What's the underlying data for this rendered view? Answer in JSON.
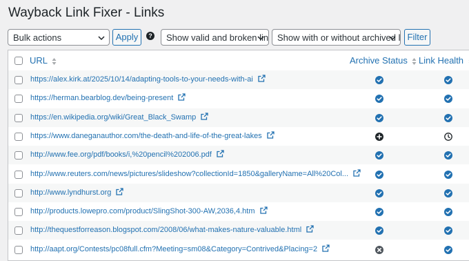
{
  "page": {
    "title": "Wayback Link Fixer - Links"
  },
  "toolbar": {
    "bulk_actions": "Bulk actions",
    "apply_label": "Apply",
    "help_glyph": "?",
    "validity_filter": "Show valid and broken links",
    "archive_filter": "Show with or without archived link",
    "filter_label": "Filter"
  },
  "table": {
    "columns": {
      "url": "URL",
      "archive_status": "Archive Status",
      "link_health": "Link Health"
    },
    "rows": [
      {
        "url": "https://alex.kirk.at/2025/10/14/adapting-tools-to-your-needs-with-ai",
        "archive_status": "archived",
        "link_health": "valid"
      },
      {
        "url": "https://herman.bearblog.dev/being-present",
        "archive_status": "archived",
        "link_health": "valid"
      },
      {
        "url": "https://en.wikipedia.org/wiki/Great_Black_Swamp",
        "archive_status": "archived",
        "link_health": "valid"
      },
      {
        "url": "https://www.daneganauthor.com/the-death-and-life-of-the-great-lakes",
        "archive_status": "add",
        "link_health": "pending"
      },
      {
        "url": "http://www.fee.org/pdf/books/i,%20pencil%202006.pdf",
        "archive_status": "archived",
        "link_health": "valid"
      },
      {
        "url": "http://www.reuters.com/news/pictures/slideshow?collectionId=1850&galleryName=All%20Col...",
        "archive_status": "archived",
        "link_health": "valid"
      },
      {
        "url": "http://www.lyndhurst.org",
        "archive_status": "archived",
        "link_health": "valid"
      },
      {
        "url": "http://products.lowepro.com/product/SlingShot-300-AW,2036,4.htm",
        "archive_status": "archived",
        "link_health": "valid"
      },
      {
        "url": "http://thequestforreason.blogspot.com/2008/06/what-makes-nature-valuable.html",
        "archive_status": "archived",
        "link_health": "valid"
      },
      {
        "url": "http://aapt.org/Contests/pc08full.cfm?Meeting=sm08&Category=Contrived&Placing=2",
        "archive_status": "unavailable",
        "link_health": "valid"
      }
    ]
  },
  "icons": {
    "archived": "check-circle-icon",
    "valid": "check-circle-icon",
    "add": "plus-circle-icon",
    "pending": "clock-icon",
    "unavailable": "x-circle-icon",
    "external": "external-link-icon"
  },
  "colors": {
    "accent": "#2271b1",
    "check": "#2271b1",
    "dark": "#1d2327",
    "unavailable": "#50575e",
    "background": "#f0f0f1"
  }
}
